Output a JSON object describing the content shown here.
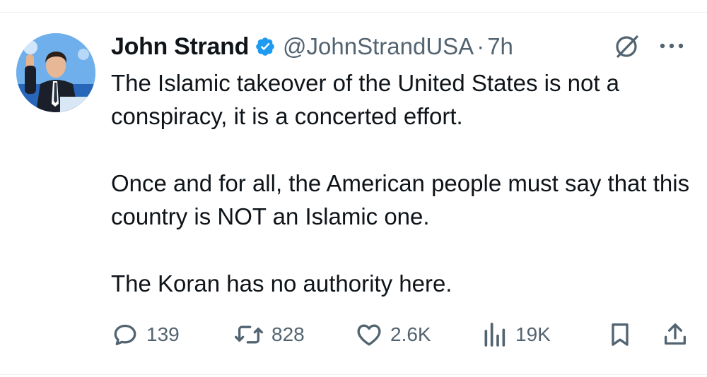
{
  "tweet": {
    "author_name": "John Strand",
    "handle": "@JohnStrandUSA",
    "separator": "·",
    "time": "7h",
    "paragraphs": [
      "The Islamic takeover of the United States is not a conspiracy, it is a concerted effort.",
      "Once and for all, the American people must say that this country is NOT an Islamic one.",
      "The Koran has no authority here."
    ]
  },
  "actions": {
    "replies": "139",
    "reposts": "828",
    "likes": "2.6K",
    "views": "19K"
  },
  "icons": {
    "verified": "verified-badge-icon",
    "grok": "grok-icon",
    "more": "more-icon",
    "reply": "reply-icon",
    "repost": "repost-icon",
    "like": "heart-icon",
    "views": "views-chart-icon",
    "bookmark": "bookmark-icon",
    "share": "share-icon"
  },
  "colors": {
    "text": "#0f1419",
    "secondary": "#536471",
    "verified_blue": "#1d9bf0",
    "divider": "#eff3f4"
  }
}
